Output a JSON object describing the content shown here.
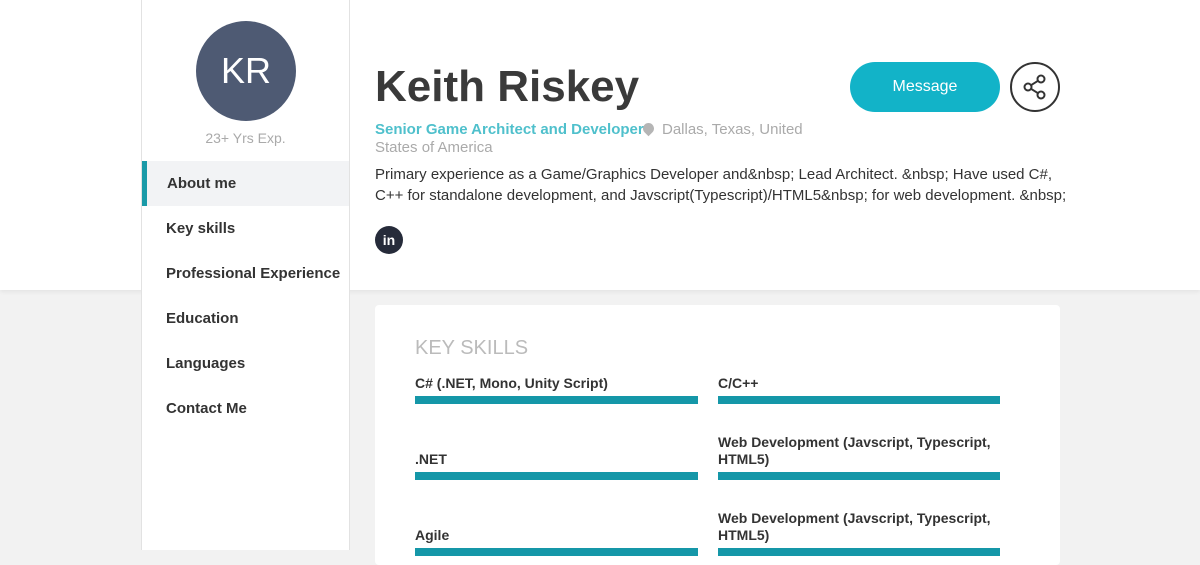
{
  "profile": {
    "initials": "KR",
    "experience": "23+ Yrs Exp.",
    "name": "Keith Riskey",
    "title": "Senior Game Architect and Developer",
    "location": "Dallas, Texas, United States of America",
    "description": "Primary experience as a Game/Graphics Developer and&nbsp; Lead Architect. &nbsp; Have used C#, C++ for standalone development, and Javscript(Typescript)/HTML5&nbsp; for web development. &nbsp;",
    "linkedin": "in"
  },
  "actions": {
    "message": "Message"
  },
  "nav": [
    "About me",
    "Key skills",
    "Professional Experience",
    "Education",
    "Languages",
    "Contact Me"
  ],
  "skills_section": {
    "heading": "KEY SKILLS",
    "skills": [
      {
        "name": "C# (.NET, Mono, Unity Script)",
        "level": 100
      },
      {
        "name": "C/C++",
        "level": 100
      },
      {
        "name": ".NET",
        "level": 100
      },
      {
        "name": "Web Development (Javscript, Typescript, HTML5)",
        "level": 100
      },
      {
        "name": "Agile",
        "level": 100
      },
      {
        "name": "Web Development (Javscript, Typescript, HTML5)",
        "level": 100
      }
    ]
  },
  "colors": {
    "accent": "#12b3c8",
    "bar": "#1597a8",
    "avatar": "#4e5a73"
  }
}
